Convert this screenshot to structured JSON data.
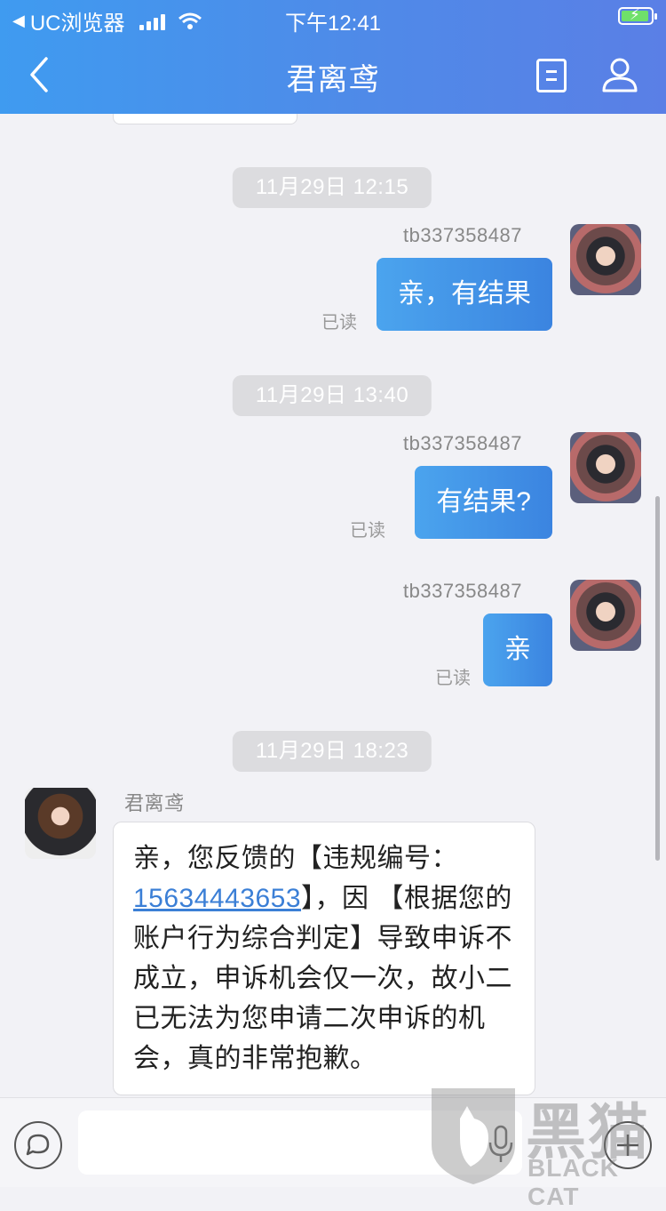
{
  "status_bar": {
    "browser": "UC浏览器",
    "time": "下午12:41"
  },
  "nav": {
    "title": "君离鸢"
  },
  "messages": [
    {
      "time": "11月29日 12:15",
      "sender": "tb337358487",
      "text": "亲，有结果",
      "read": "已读"
    },
    {
      "time": "11月29日 13:40",
      "sender": "tb337358487",
      "text": "有结果?",
      "read": "已读"
    },
    {
      "sender": "tb337358487",
      "text": "亲",
      "read": "已读"
    }
  ],
  "reply": {
    "time": "11月29日 18:23",
    "sender": "君离鸢",
    "text_before": "亲，您反馈的【违规编号：",
    "link": "15634443653",
    "text_after": "】，因 【根据您的账户行为综合判定】导致申诉不成立，申诉机会仅一次，故小二已无法为您申请二次申诉的机会，真的非常抱歉。"
  },
  "input": {
    "placeholder": ""
  },
  "watermark": {
    "big": "黑猫",
    "small": "BLACK CAT"
  },
  "colors": {
    "header_start": "#3f9bf0",
    "header_end": "#5a7fe6",
    "bubble_me": "#3b84e0",
    "link": "#3b7fd6"
  }
}
